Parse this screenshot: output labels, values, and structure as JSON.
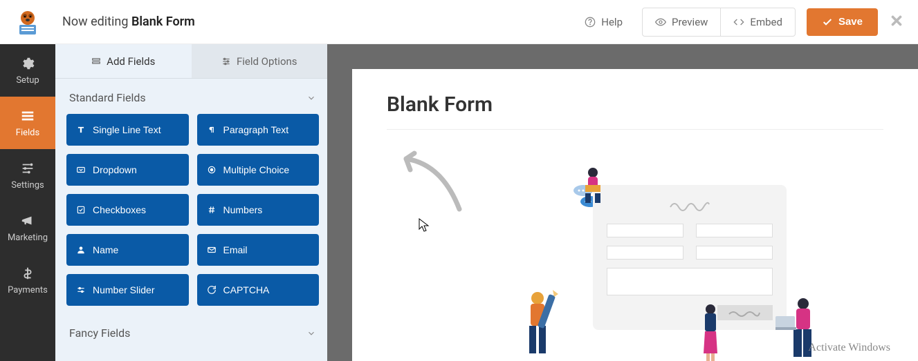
{
  "header": {
    "editing_prefix": "Now editing ",
    "form_name": "Blank Form",
    "help": "Help",
    "preview": "Preview",
    "embed": "Embed",
    "save": "Save"
  },
  "nav": [
    {
      "label": "Setup",
      "icon": "gear"
    },
    {
      "label": "Fields",
      "icon": "form",
      "active": true
    },
    {
      "label": "Settings",
      "icon": "sliders"
    },
    {
      "label": "Marketing",
      "icon": "bullhorn"
    },
    {
      "label": "Payments",
      "icon": "dollar"
    }
  ],
  "panel": {
    "tab_add": "Add Fields",
    "tab_options": "Field Options",
    "section_standard": "Standard Fields",
    "section_fancy": "Fancy Fields",
    "fields": [
      {
        "label": "Single Line Text",
        "icon": "text"
      },
      {
        "label": "Paragraph Text",
        "icon": "paragraph"
      },
      {
        "label": "Dropdown",
        "icon": "dropdown"
      },
      {
        "label": "Multiple Choice",
        "icon": "radio"
      },
      {
        "label": "Checkboxes",
        "icon": "check"
      },
      {
        "label": "Numbers",
        "icon": "hash"
      },
      {
        "label": "Name",
        "icon": "user"
      },
      {
        "label": "Email",
        "icon": "mail"
      },
      {
        "label": "Number Slider",
        "icon": "slider"
      },
      {
        "label": "CAPTCHA",
        "icon": "captcha"
      }
    ]
  },
  "canvas": {
    "title": "Blank Form"
  },
  "watermark": "Activate Windows"
}
